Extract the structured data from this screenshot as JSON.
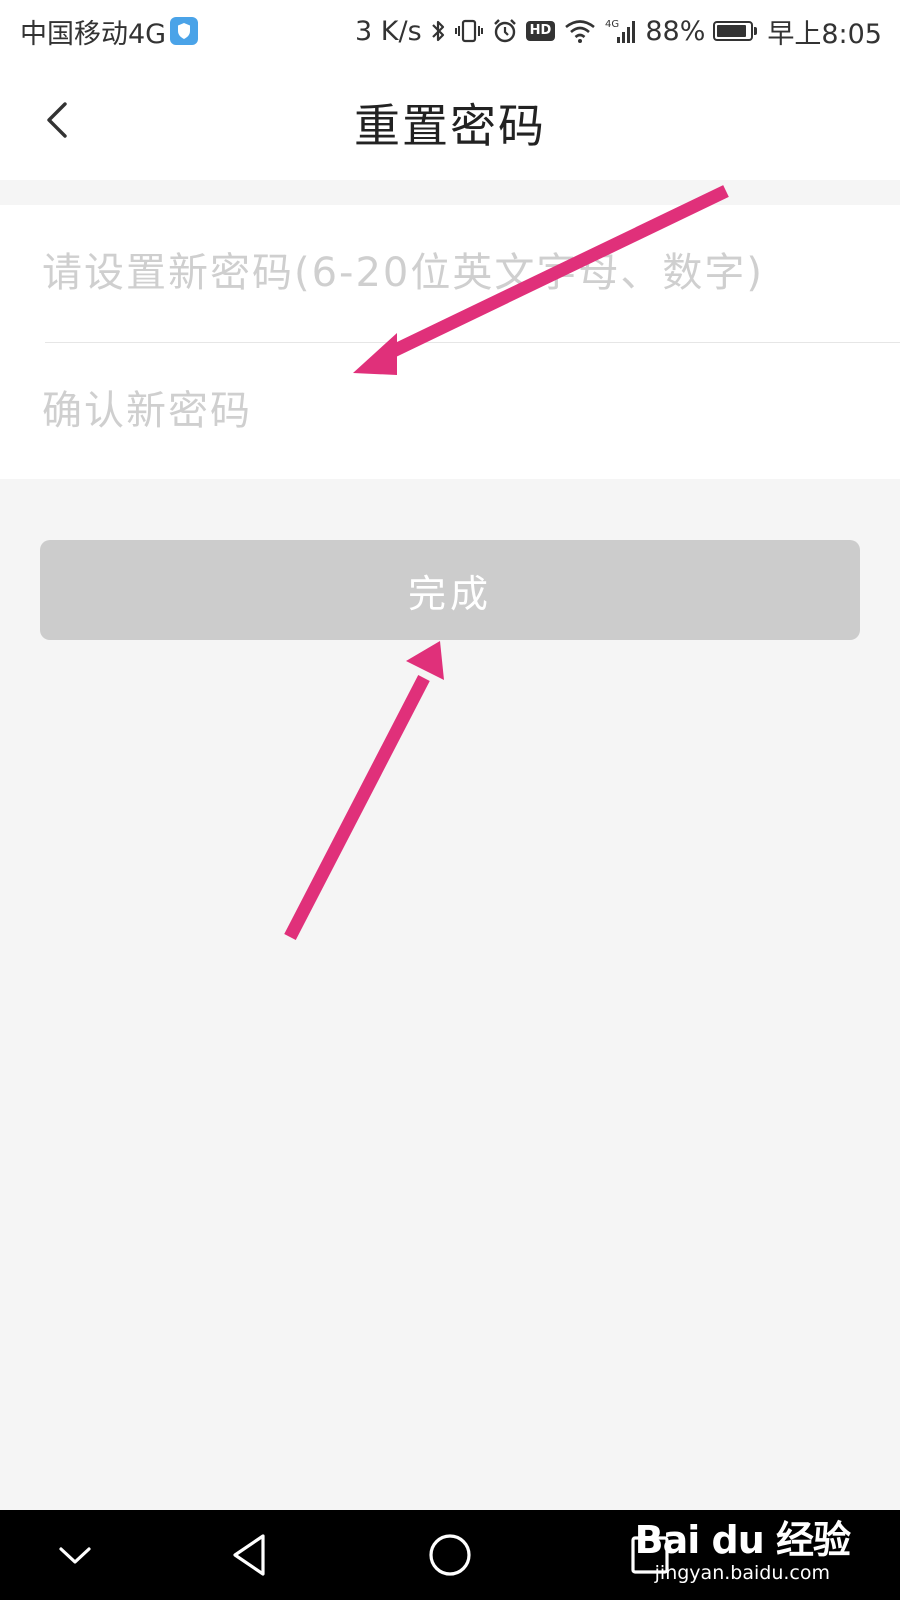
{
  "status_bar": {
    "carrier": "中国移动4G",
    "speed": "3 K/s",
    "battery": "88%",
    "battery_level": 0.88,
    "time": "早上8:05",
    "hd_label": "HD",
    "net_label": "4G"
  },
  "header": {
    "title": "重置密码"
  },
  "form": {
    "new_password_placeholder": "请设置新密码(6-20位英文字母、数字)",
    "confirm_password_placeholder": "确认新密码"
  },
  "submit_label": "完成",
  "watermark": {
    "logo": "Bai du 经验",
    "url": "jingyan.baidu.com"
  },
  "colors": {
    "arrow": "#e0307a",
    "button_disabled": "#cccccc",
    "background": "#f5f5f5"
  },
  "icons": {
    "back": "chevron-left-icon",
    "nav_hide": "chevron-down-icon",
    "nav_back": "triangle-back-icon",
    "nav_home": "circle-home-icon",
    "nav_recent": "square-recent-icon"
  }
}
